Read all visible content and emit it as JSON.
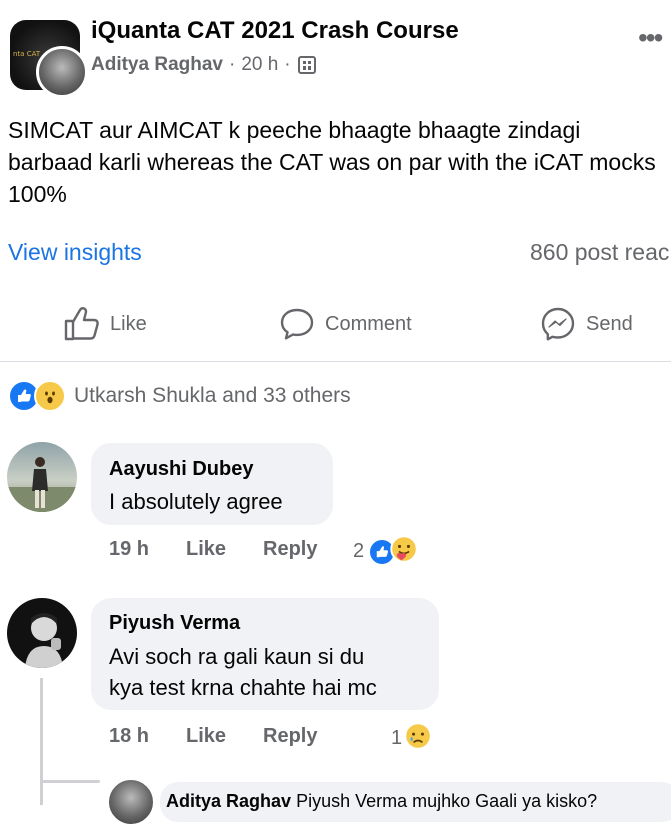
{
  "post": {
    "group_name": "iQuanta CAT 2021 Crash Course",
    "group_avatar_text": "nta CAT",
    "author": "Aditya Raghav",
    "separator": "·",
    "time": "20 h",
    "separator2": "·",
    "body": "SIMCAT aur AIMCAT k peeche bhaagte bhaagte zindagi barbaad karli whereas the CAT was on par with the iCAT mocks 100%",
    "more_icon": "•••"
  },
  "insights": {
    "link": "View insights",
    "reach": "860 post reac"
  },
  "actions": {
    "like": "Like",
    "comment": "Comment",
    "send": "Send"
  },
  "reactions": {
    "summary": "Utkarsh Shukla and 33 others"
  },
  "comments": [
    {
      "name": "Aayushi Dubey",
      "text": "I absolutely agree",
      "time": "19 h",
      "like": "Like",
      "reply": "Reply",
      "reaction_count": "2"
    },
    {
      "name": "Piyush Verma",
      "text_line1": "Avi soch ra gali kaun si du",
      "text_line2": "kya test krna chahte hai mc",
      "time": "18 h",
      "like": "Like",
      "reply": "Reply",
      "reaction_count": "1"
    }
  ],
  "reply_preview": {
    "name": "Aditya Raghav",
    "text": "Piyush Verma mujhko Gaali ya kisko?"
  },
  "colors": {
    "link_blue": "#1b74e4",
    "secondary": "#65676b",
    "bubble": "#f0f2f5",
    "like_blue": "#1877f2"
  }
}
